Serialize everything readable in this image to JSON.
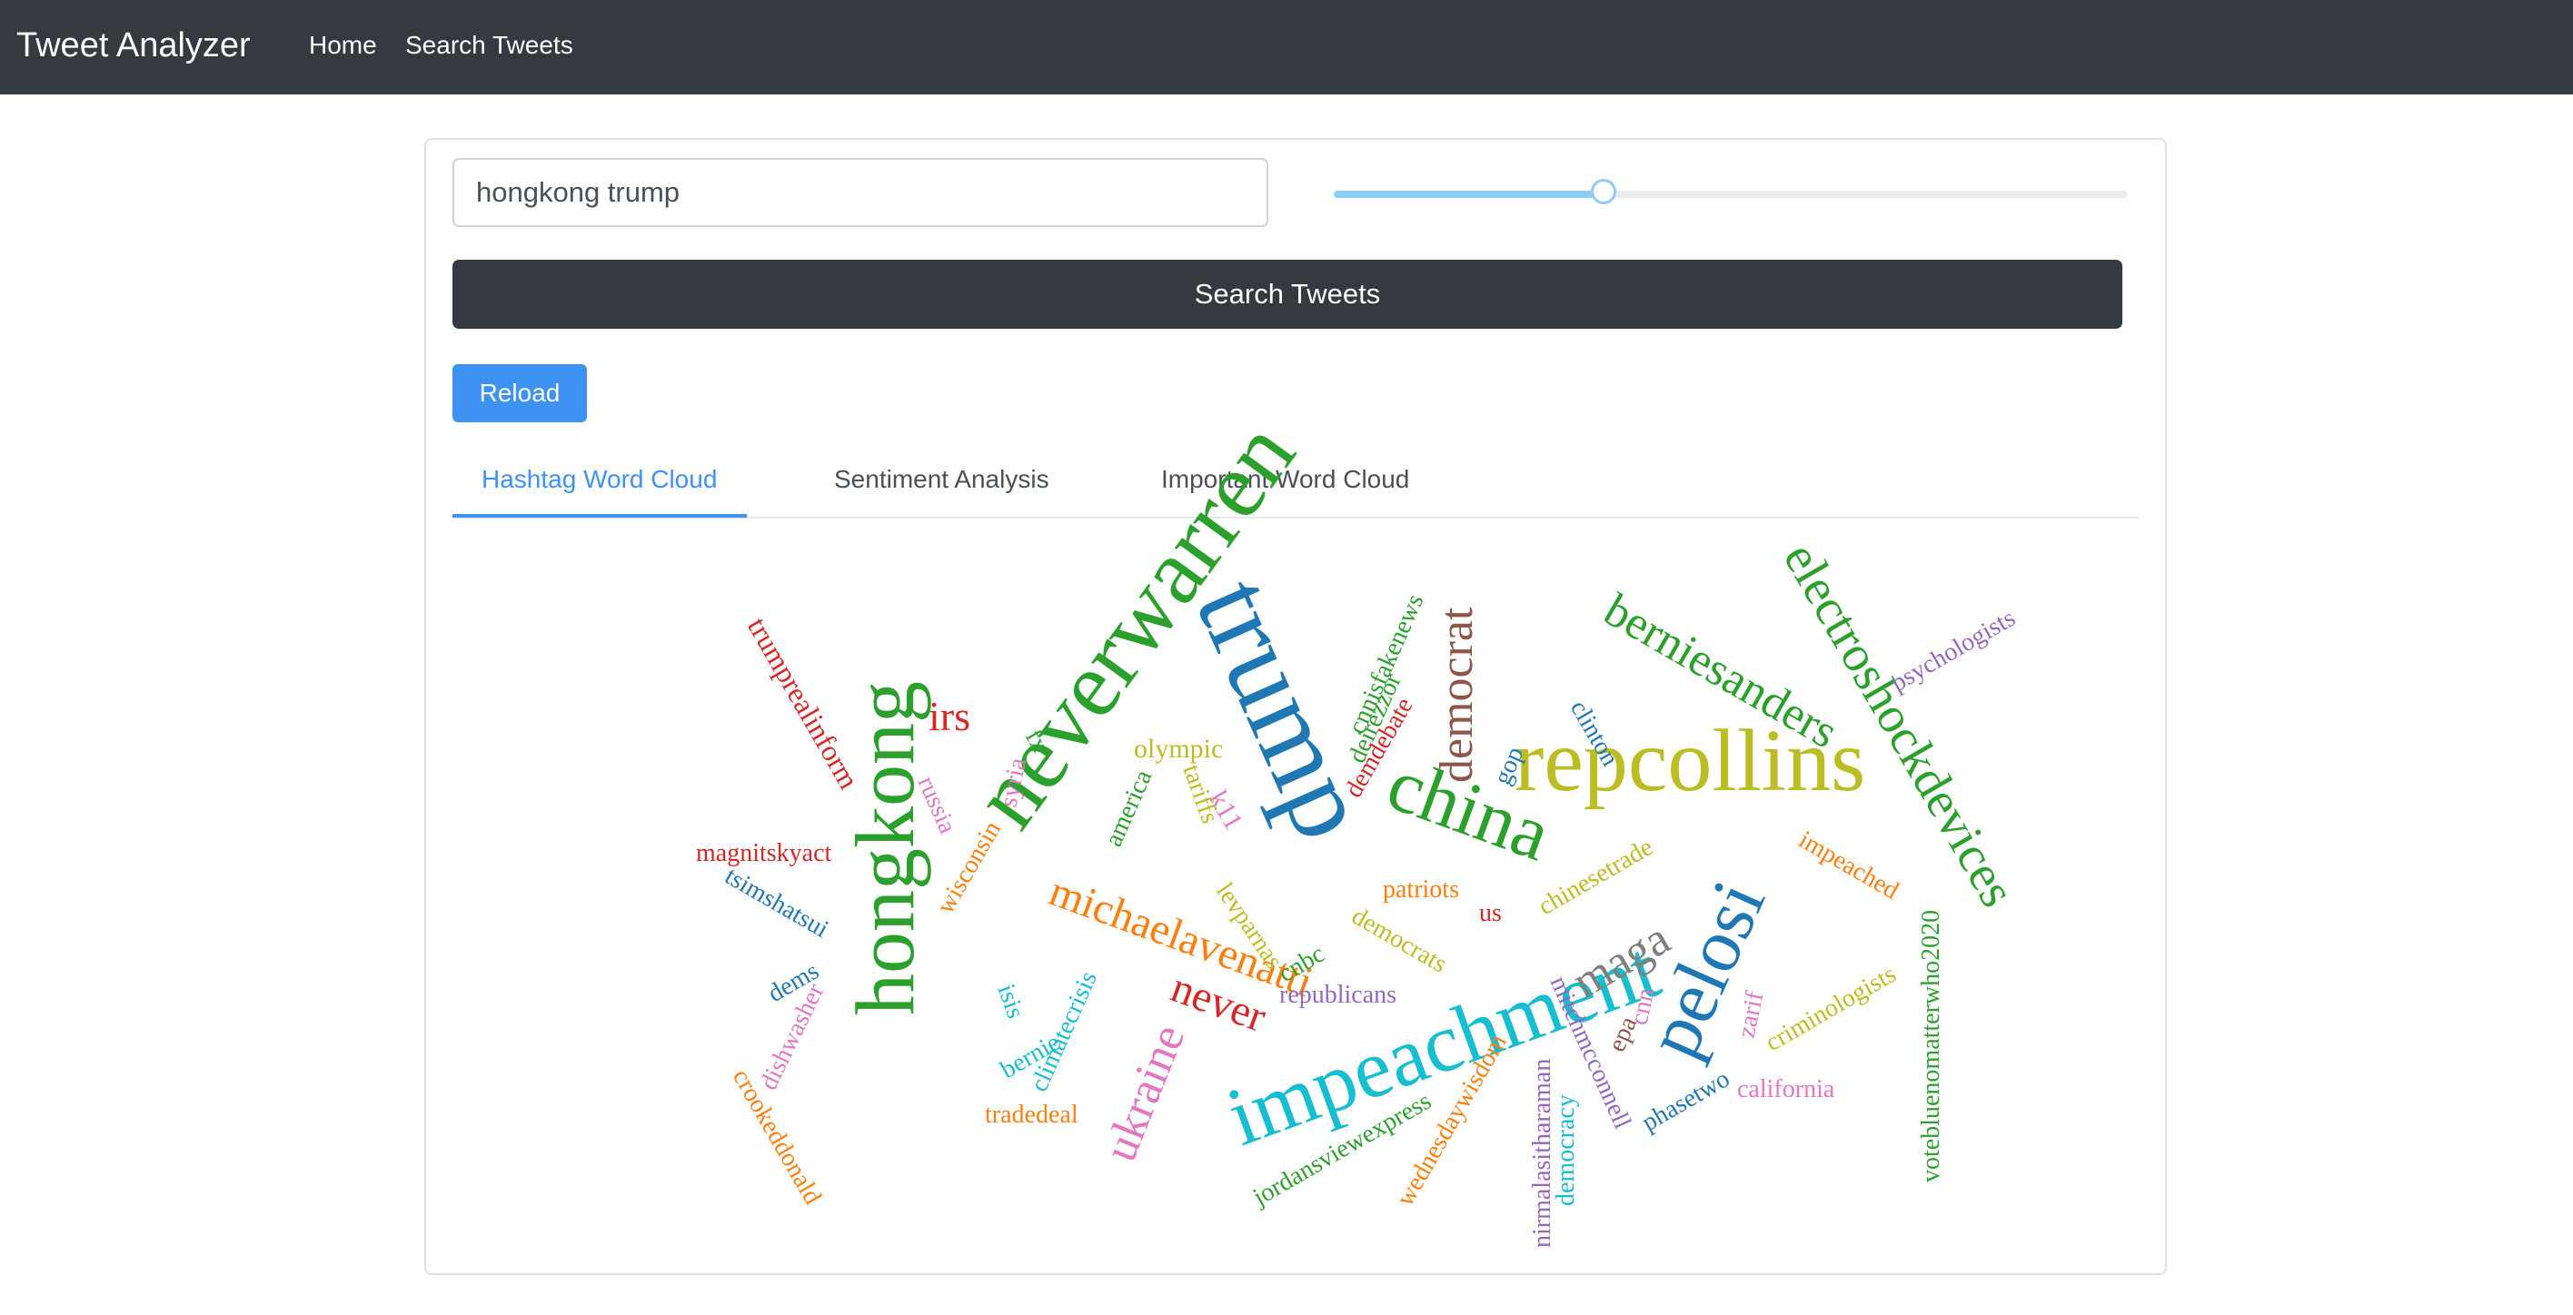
{
  "app": {
    "brand": "Tweet Analyzer",
    "nav": [
      {
        "label": "Home"
      },
      {
        "label": "Search Tweets"
      }
    ]
  },
  "search": {
    "query": "hongkong trump",
    "button_label": "Search Tweets",
    "slider_level_fraction": 0.34,
    "slider_color": "#8fcdf6"
  },
  "reload": {
    "label": "Reload"
  },
  "tabs": [
    {
      "label": "Hashtag Word Cloud",
      "active": true
    },
    {
      "label": "Sentiment Analysis",
      "active": false
    },
    {
      "label": "Important Word Cloud",
      "active": false
    }
  ],
  "colors": {
    "navbar": "#343a40",
    "accent": "#3e92f2"
  },
  "wordcloud": {
    "words": [
      {
        "text": "trumprealinform",
        "color": "#d62728"
      },
      {
        "text": "irs",
        "color": "#d62728"
      },
      {
        "text": "hongkong",
        "color": "#2ca02c"
      },
      {
        "text": "neverwarren",
        "color": "#2ca02c"
      },
      {
        "text": "trump",
        "color": "#1f77b4"
      },
      {
        "text": "cnnisfakenews",
        "color": "#2ca02c"
      },
      {
        "text": "deirezzor",
        "color": "#2ca02c"
      },
      {
        "text": "demdebate",
        "color": "#d62728"
      },
      {
        "text": "democrat",
        "color": "#8c564b"
      },
      {
        "text": "berniesanders",
        "color": "#2ca02c"
      },
      {
        "text": "electroshockdevices",
        "color": "#2ca02c"
      },
      {
        "text": "psychologists",
        "color": "#9467bd"
      },
      {
        "text": "repcollins",
        "color": "#bcbd22"
      },
      {
        "text": "china",
        "color": "#2ca02c"
      },
      {
        "text": "gop",
        "color": "#1f77b4"
      },
      {
        "text": "clinton",
        "color": "#1f77b4"
      },
      {
        "text": "olympic",
        "color": "#bcbd22"
      },
      {
        "text": "k11",
        "color": "#e377c2"
      },
      {
        "text": "tariffs",
        "color": "#bcbd22"
      },
      {
        "text": "america",
        "color": "#2ca02c"
      },
      {
        "text": "fx",
        "color": "#2ca02c"
      },
      {
        "text": "syria",
        "color": "#e377c2"
      },
      {
        "text": "russia",
        "color": "#e377c2"
      },
      {
        "text": "wisconsin",
        "color": "#ff7f0e"
      },
      {
        "text": "magnitskyact",
        "color": "#d62728"
      },
      {
        "text": "tsimshatsui",
        "color": "#1f77b4"
      },
      {
        "text": "dems",
        "color": "#1f77b4"
      },
      {
        "text": "dishwasher",
        "color": "#e377c2"
      },
      {
        "text": "crookeddonald",
        "color": "#ff7f0e"
      },
      {
        "text": "michaelavenatti",
        "color": "#ff7f0e"
      },
      {
        "text": "never",
        "color": "#d62728"
      },
      {
        "text": "isis",
        "color": "#17becf"
      },
      {
        "text": "bernie",
        "color": "#17becf"
      },
      {
        "text": "climatecrisis",
        "color": "#17becf"
      },
      {
        "text": "tradedeal",
        "color": "#ff7f0e"
      },
      {
        "text": "ukraine",
        "color": "#e377c2"
      },
      {
        "text": "impeachment",
        "color": "#17becf"
      },
      {
        "text": "pelosi",
        "color": "#1f77b4"
      },
      {
        "text": "maga",
        "color": "#7f7f7f"
      },
      {
        "text": "chinesetrade",
        "color": "#bcbd22"
      },
      {
        "text": "patriots",
        "color": "#ff7f0e"
      },
      {
        "text": "us",
        "color": "#d62728"
      },
      {
        "text": "democrats",
        "color": "#bcbd22"
      },
      {
        "text": "cnbc",
        "color": "#2ca02c"
      },
      {
        "text": "republicans",
        "color": "#9467bd"
      },
      {
        "text": "levparnas",
        "color": "#bcbd22"
      },
      {
        "text": "impeached",
        "color": "#ff7f0e"
      },
      {
        "text": "votebluenomatterwho2020",
        "color": "#2ca02c"
      },
      {
        "text": "criminologists",
        "color": "#bcbd22"
      },
      {
        "text": "zarif",
        "color": "#e377c2"
      },
      {
        "text": "california",
        "color": "#e377c2"
      },
      {
        "text": "phasetwo",
        "color": "#1f77b4"
      },
      {
        "text": "cnn",
        "color": "#e377c2"
      },
      {
        "text": "epa",
        "color": "#8c564b"
      },
      {
        "text": "mitchmcconnell",
        "color": "#9467bd"
      },
      {
        "text": "democracy",
        "color": "#17becf"
      },
      {
        "text": "nirmalasitharaman",
        "color": "#9467bd"
      },
      {
        "text": "wednesdaywisdom",
        "color": "#ff7f0e"
      },
      {
        "text": "jordansviewexpress",
        "color": "#2ca02c"
      }
    ]
  }
}
